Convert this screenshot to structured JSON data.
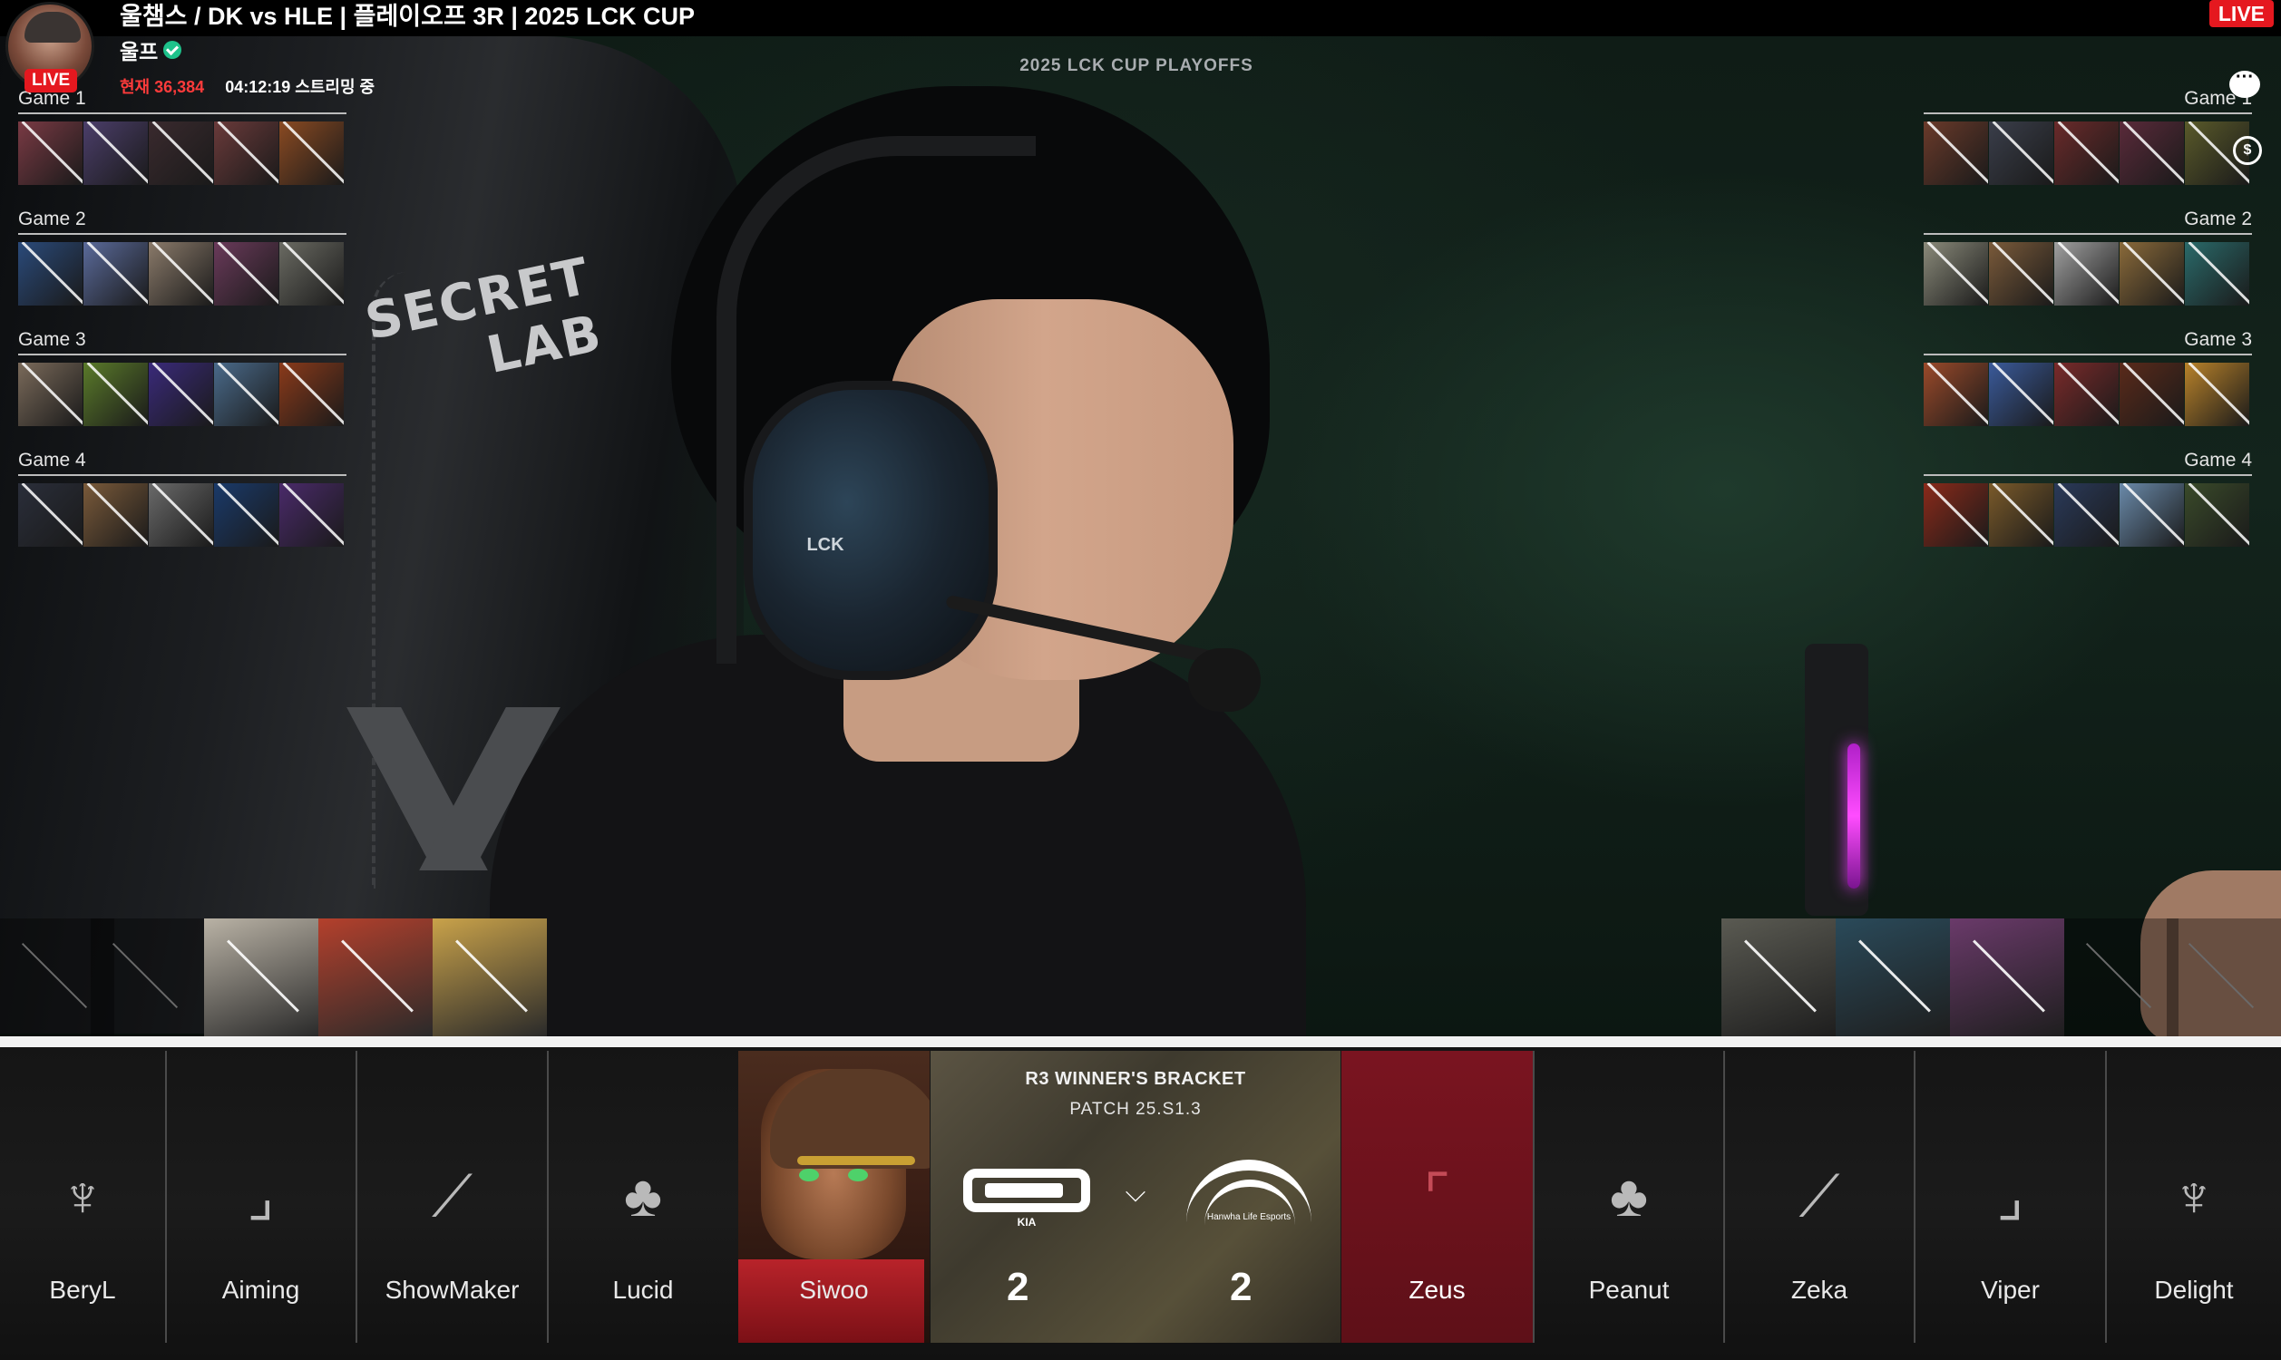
{
  "stream": {
    "title": "울챔스 / DK vs HLE | 플레이오프 3R | 2025 LCK CUP",
    "channel": "울프",
    "live_badge": "LIVE",
    "viewers_label": "현재",
    "viewers_count": "36,384",
    "uptime": "04:12:19 스트리밍 중",
    "live_top": "LIVE"
  },
  "overlay": {
    "event_title": "2025 LCK CUP PLAYOFFS"
  },
  "ban_history": {
    "left": [
      {
        "label": "Game 1",
        "colors": [
          "#7a3a44",
          "#4b3e6a",
          "#3a2a2e",
          "#6a3a3a",
          "#8a4a22"
        ]
      },
      {
        "label": "Game 2",
        "colors": [
          "#2a4a7a",
          "#5a6a9a",
          "#8a7a6a",
          "#6a3a5a",
          "#6a6a62"
        ]
      },
      {
        "label": "Game 3",
        "colors": [
          "#7a6a5a",
          "#5a7a2a",
          "#3a2a7a",
          "#4a6a8a",
          "#8a3a1a"
        ]
      },
      {
        "label": "Game 4",
        "colors": [
          "#2a2e3a",
          "#7a5a3a",
          "#6a6a6a",
          "#1a3a6a",
          "#4a2a6a"
        ]
      }
    ],
    "right": [
      {
        "label": "Game 1",
        "colors": [
          "#6a3a2a",
          "#3a3e4a",
          "#6a2a2a",
          "#5a2a3a",
          "#5a5a2a"
        ]
      },
      {
        "label": "Game 2",
        "colors": [
          "#8a8a7a",
          "#7a5a3a",
          "#a0a0a0",
          "#8a6a3a",
          "#2a6a6a"
        ]
      },
      {
        "label": "Game 3",
        "colors": [
          "#9a4a2a",
          "#3a5a9a",
          "#7a2a2a",
          "#5a2a1a",
          "#b8822a"
        ]
      },
      {
        "label": "Game 4",
        "colors": [
          "#8a2a1a",
          "#7a5a2a",
          "#2a3a5a",
          "#6a8aaa",
          "#3a4a2a"
        ]
      }
    ]
  },
  "current_bans": {
    "left_colors": [
      "#b9b2a5",
      "#b4402c",
      "#c9a24a"
    ],
    "right_colors": [
      "#5a5a52",
      "#2a4a5a",
      "#6a3a6a"
    ]
  },
  "picks": {
    "blue": [
      {
        "name": "BeryL",
        "role_icon": "support-role-icon",
        "glyph": "♆"
      },
      {
        "name": "Aiming",
        "role_icon": "bot-role-icon",
        "glyph": "⌟"
      },
      {
        "name": "ShowMaker",
        "role_icon": "mid-role-icon",
        "glyph": "⟋"
      },
      {
        "name": "Lucid",
        "role_icon": "jungle-role-icon",
        "glyph": "♣"
      },
      {
        "name": "Siwoo",
        "role_icon": "top-role-icon",
        "glyph": ""
      }
    ],
    "red": [
      {
        "name": "Zeus",
        "role_icon": "top-role-icon",
        "glyph": "⌜"
      },
      {
        "name": "Peanut",
        "role_icon": "jungle-role-icon",
        "glyph": "♣"
      },
      {
        "name": "Zeka",
        "role_icon": "mid-role-icon",
        "glyph": "⟋"
      },
      {
        "name": "Viper",
        "role_icon": "bot-role-icon",
        "glyph": "⌟"
      },
      {
        "name": "Delight",
        "role_icon": "support-role-icon",
        "glyph": "♆"
      }
    ]
  },
  "match": {
    "bracket": "R3 WINNER'S BRACKET",
    "patch": "PATCH 25.S1.3",
    "dk_sub": "KIA",
    "hle_sub": "Hanwha Life Esports",
    "vs_glyph": "⌵",
    "score_left": "2",
    "score_right": "2"
  },
  "chair_logo": "SECRET\nLAB",
  "headset_logo": "LCK"
}
